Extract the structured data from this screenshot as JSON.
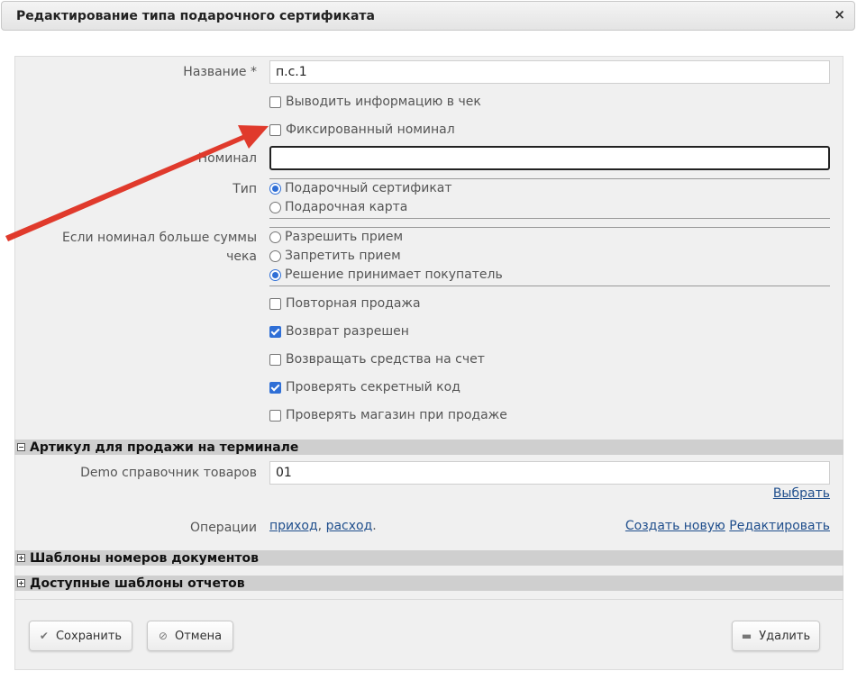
{
  "dialog": {
    "title": "Редактирование типа подарочного сертификата",
    "close_icon": "×"
  },
  "form": {
    "name_label": "Название *",
    "name_value": "п.с.1",
    "print_info_label": "Выводить информацию в чек",
    "print_info_checked": false,
    "fixed_nominal_label": "Фиксированный номинал",
    "fixed_nominal_checked": false,
    "nominal_label": "Номинал",
    "nominal_value": "",
    "type_label": "Тип",
    "type_options": [
      {
        "label": "Подарочный сертификат",
        "selected": true
      },
      {
        "label": "Подарочная карта",
        "selected": false
      }
    ],
    "overflow_label": "Если номинал больше суммы чека",
    "overflow_options": [
      {
        "label": "Разрешить прием",
        "selected": false
      },
      {
        "label": "Запретить прием",
        "selected": false
      },
      {
        "label": "Решение принимает покупатель",
        "selected": true
      }
    ],
    "checkboxes": [
      {
        "label": "Повторная продажа",
        "checked": false
      },
      {
        "label": "Возврат разрешен",
        "checked": true
      },
      {
        "label": "Возвращать средства на счет",
        "checked": false
      },
      {
        "label": "Проверять секретный код",
        "checked": true
      },
      {
        "label": "Проверять магазин при продаже",
        "checked": false
      }
    ]
  },
  "terminal_section": {
    "title": "Артикул для продажи на терминале",
    "expanded": true,
    "catalog_label": "Demo справочник товаров",
    "catalog_value": "01",
    "choose_link": "Выбрать",
    "operations_label": "Операции",
    "operation_links": [
      "приход",
      "расход"
    ],
    "operations_end": ".",
    "create_link": "Создать новую",
    "edit_link": "Редактировать"
  },
  "sections": [
    {
      "title": "Шаблоны номеров документов",
      "expanded": false
    },
    {
      "title": "Доступные шаблоны отчетов",
      "expanded": false
    }
  ],
  "buttons": {
    "save": {
      "label": "Сохранить",
      "icon": "check-icon"
    },
    "cancel": {
      "label": "Отмена",
      "icon": "cancel-circle-icon"
    },
    "delete": {
      "label": "Удалить",
      "icon": "minus-icon"
    }
  },
  "annotation": {
    "arrow_color": "#e03a2c"
  }
}
